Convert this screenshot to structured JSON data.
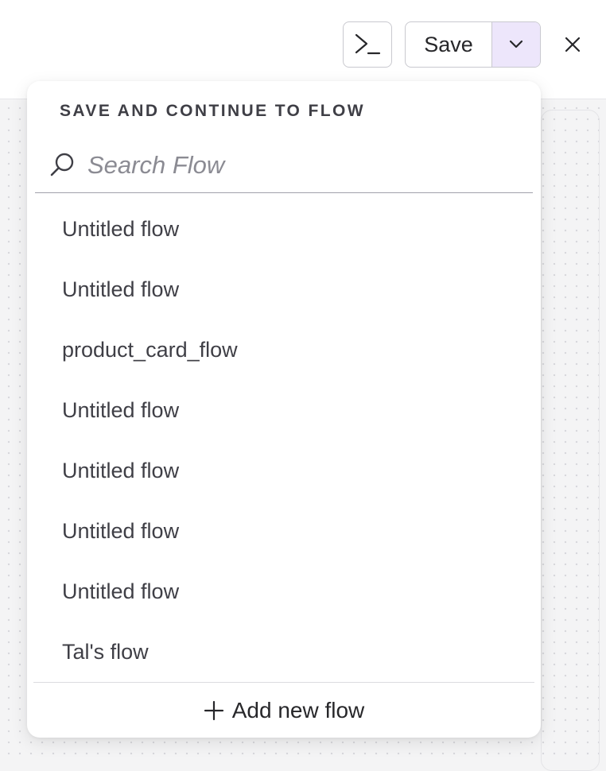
{
  "toolbar": {
    "terminal_icon": "terminal-icon",
    "save_label": "Save",
    "caret_icon": "chevron-down-icon",
    "close_icon": "close-icon",
    "caret_bg": "#ede6fb"
  },
  "dropdown": {
    "title": "SAVE AND CONTINUE TO FLOW",
    "search": {
      "placeholder": "Search Flow",
      "value": "",
      "icon": "search-icon"
    },
    "flows": [
      {
        "label": "Untitled flow"
      },
      {
        "label": "Untitled flow"
      },
      {
        "label": "product_card_flow"
      },
      {
        "label": "Untitled flow"
      },
      {
        "label": "Untitled flow"
      },
      {
        "label": "Untitled flow"
      },
      {
        "label": "Untitled flow"
      },
      {
        "label": "Tal's flow"
      }
    ],
    "add_label": "Add new flow",
    "add_icon": "plus-icon"
  }
}
